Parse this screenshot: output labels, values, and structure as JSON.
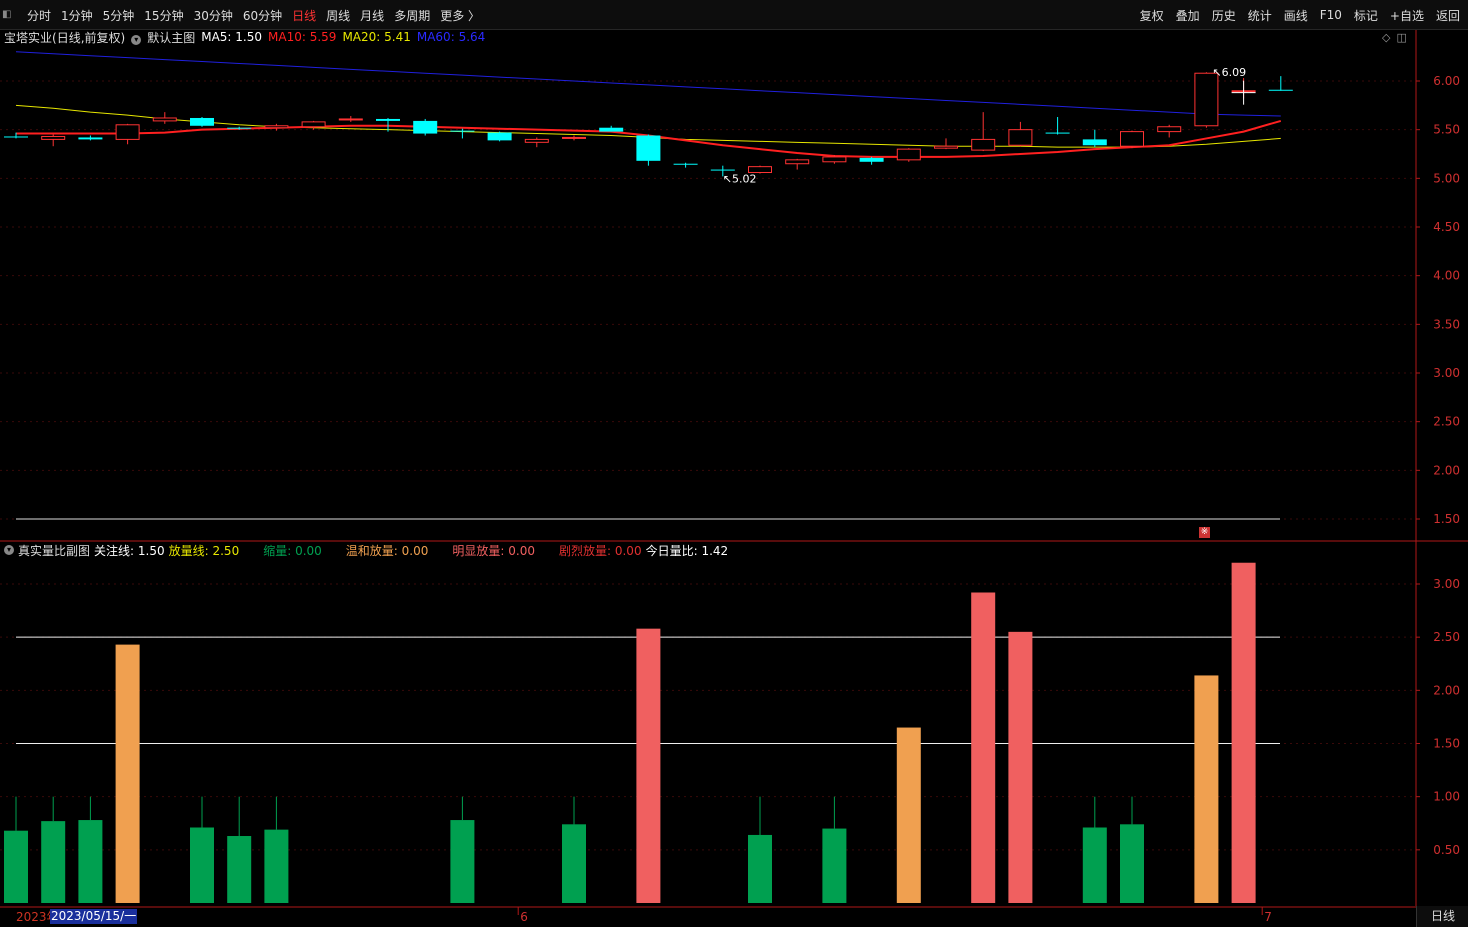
{
  "toolbar": {
    "periods": [
      "分时",
      "1分钟",
      "5分钟",
      "15分钟",
      "30分钟",
      "60分钟",
      "日线",
      "周线",
      "月线",
      "多周期",
      "更多 〉"
    ],
    "active_period": "日线",
    "tools": [
      "复权",
      "叠加",
      "历史",
      "统计",
      "画线",
      "F10",
      "标记",
      "+自选",
      "返回"
    ]
  },
  "main_info": {
    "stock_name": "宝塔实业",
    "mode": "(日线,前复权)",
    "template": "默认主图",
    "ma5_label": "MA5:",
    "ma5_value": "1.50",
    "ma10_label": "MA10:",
    "ma10_value": "5.59",
    "ma20_label": "MA20:",
    "ma20_value": "5.41",
    "ma60_label": "MA60:",
    "ma60_value": "5.64"
  },
  "sub_info": {
    "title": "真实量比副图",
    "focus_label": "关注线:",
    "focus_value": "1.50",
    "expand_label": "放量线:",
    "expand_value": "2.50",
    "shrink_label": "缩量:",
    "shrink_value": "0.00",
    "mild_label": "温和放量:",
    "mild_value": "0.00",
    "obvious_label": "明显放量:",
    "obvious_value": "0.00",
    "fierce_label": "剧烈放量:",
    "fierce_value": "0.00",
    "today_label": "今日量比:",
    "today_value": "1.42"
  },
  "colors": {
    "up": "#ff3333",
    "down": "#00ffff",
    "ma5": "#ffffff",
    "ma10": "#ff2020",
    "ma20": "#e6e600",
    "ma60": "#2020dd",
    "shrink": "#00a050",
    "mild": "#f0a050",
    "obvious": "#f06060",
    "axis": "#b01818"
  },
  "bottom": {
    "date_left": "2023年",
    "date_selected": "2023/05/15/一",
    "month_6": "6",
    "month_7": "7",
    "period": "日线"
  },
  "chart_data": [
    {
      "type": "candlestick",
      "yticks": [
        "6.00",
        "5.50",
        "5.00",
        "4.50",
        "4.00",
        "3.50",
        "3.00",
        "2.50",
        "2.00",
        "1.50"
      ],
      "ylim": [
        1.5,
        6.0
      ],
      "annotations": [
        {
          "text": "6.09",
          "label": "high"
        },
        {
          "text": "5.02",
          "label": "low"
        }
      ],
      "candles": [
        {
          "o": 5.43,
          "h": 5.47,
          "l": 5.41,
          "c": 5.42
        },
        {
          "o": 5.4,
          "h": 5.45,
          "l": 5.33,
          "c": 5.43
        },
        {
          "o": 5.42,
          "h": 5.44,
          "l": 5.39,
          "c": 5.4
        },
        {
          "o": 5.4,
          "h": 5.56,
          "l": 5.35,
          "c": 5.55
        },
        {
          "o": 5.59,
          "h": 5.68,
          "l": 5.56,
          "c": 5.62
        },
        {
          "o": 5.62,
          "h": 5.63,
          "l": 5.53,
          "c": 5.54
        },
        {
          "o": 5.52,
          "h": 5.53,
          "l": 5.5,
          "c": 5.51
        },
        {
          "o": 5.52,
          "h": 5.56,
          "l": 5.49,
          "c": 5.54
        },
        {
          "o": 5.53,
          "h": 5.59,
          "l": 5.5,
          "c": 5.58
        },
        {
          "o": 5.61,
          "h": 5.64,
          "l": 5.58,
          "c": 5.61
        },
        {
          "o": 5.61,
          "h": 5.62,
          "l": 5.48,
          "c": 5.59
        },
        {
          "o": 5.59,
          "h": 5.61,
          "l": 5.44,
          "c": 5.46
        },
        {
          "o": 5.49,
          "h": 5.51,
          "l": 5.41,
          "c": 5.48
        },
        {
          "o": 5.47,
          "h": 5.48,
          "l": 5.38,
          "c": 5.39
        },
        {
          "o": 5.37,
          "h": 5.42,
          "l": 5.32,
          "c": 5.4
        },
        {
          "o": 5.41,
          "h": 5.44,
          "l": 5.39,
          "c": 5.42
        },
        {
          "o": 5.52,
          "h": 5.54,
          "l": 5.48,
          "c": 5.48
        },
        {
          "o": 5.44,
          "h": 5.45,
          "l": 5.13,
          "c": 5.18
        },
        {
          "o": 5.15,
          "h": 5.16,
          "l": 5.11,
          "c": 5.14
        },
        {
          "o": 5.09,
          "h": 5.13,
          "l": 5.02,
          "c": 5.08
        },
        {
          "o": 5.06,
          "h": 5.13,
          "l": 5.05,
          "c": 5.12
        },
        {
          "o": 5.15,
          "h": 5.2,
          "l": 5.09,
          "c": 5.19
        },
        {
          "o": 5.17,
          "h": 5.24,
          "l": 5.15,
          "c": 5.22
        },
        {
          "o": 5.21,
          "h": 5.22,
          "l": 5.14,
          "c": 5.17
        },
        {
          "o": 5.19,
          "h": 5.31,
          "l": 5.17,
          "c": 5.3
        },
        {
          "o": 5.31,
          "h": 5.41,
          "l": 5.3,
          "c": 5.33
        },
        {
          "o": 5.29,
          "h": 5.68,
          "l": 5.28,
          "c": 5.4
        },
        {
          "o": 5.34,
          "h": 5.58,
          "l": 5.33,
          "c": 5.5
        },
        {
          "o": 5.47,
          "h": 5.63,
          "l": 5.45,
          "c": 5.46
        },
        {
          "o": 5.4,
          "h": 5.5,
          "l": 5.32,
          "c": 5.34
        },
        {
          "o": 5.33,
          "h": 5.49,
          "l": 5.31,
          "c": 5.48
        },
        {
          "o": 5.48,
          "h": 5.55,
          "l": 5.42,
          "c": 5.53
        },
        {
          "o": 5.54,
          "h": 6.09,
          "l": 5.52,
          "c": 6.08
        },
        {
          "o": 5.9,
          "h": 6.03,
          "l": 5.82,
          "c": 5.9
        },
        {
          "o": 5.91,
          "h": 6.05,
          "l": 5.9,
          "c": 5.9
        }
      ],
      "ma10": [
        5.46,
        5.46,
        5.46,
        5.46,
        5.47,
        5.5,
        5.51,
        5.52,
        5.53,
        5.54,
        5.54,
        5.53,
        5.52,
        5.51,
        5.5,
        5.49,
        5.48,
        5.44,
        5.39,
        5.34,
        5.3,
        5.26,
        5.23,
        5.22,
        5.22,
        5.22,
        5.23,
        5.25,
        5.27,
        5.3,
        5.32,
        5.34,
        5.41,
        5.48,
        5.59
      ],
      "ma20": [
        5.75,
        5.72,
        5.68,
        5.65,
        5.61,
        5.58,
        5.55,
        5.53,
        5.52,
        5.51,
        5.5,
        5.49,
        5.48,
        5.47,
        5.46,
        5.45,
        5.44,
        5.42,
        5.4,
        5.39,
        5.38,
        5.37,
        5.36,
        5.35,
        5.34,
        5.33,
        5.33,
        5.33,
        5.32,
        5.32,
        5.32,
        5.33,
        5.35,
        5.38,
        5.41
      ],
      "ma60": [
        6.3,
        6.28,
        6.26,
        6.24,
        6.22,
        6.2,
        6.18,
        6.16,
        6.14,
        6.12,
        6.1,
        6.08,
        6.06,
        6.04,
        6.02,
        6.0,
        5.98,
        5.96,
        5.94,
        5.92,
        5.9,
        5.88,
        5.86,
        5.84,
        5.82,
        5.8,
        5.78,
        5.76,
        5.74,
        5.72,
        5.7,
        5.68,
        5.66,
        5.65,
        5.64
      ]
    },
    {
      "type": "bar",
      "yticks": [
        "3.00",
        "2.50",
        "2.00",
        "1.50",
        "1.00",
        "0.50"
      ],
      "ylim": [
        0,
        3.3
      ],
      "reference_lines": [
        2.5,
        1.5
      ],
      "bars": [
        {
          "value": 0.68,
          "cls": "shrink"
        },
        {
          "value": 0.77,
          "cls": "shrink"
        },
        {
          "value": 0.78,
          "cls": "shrink"
        },
        {
          "value": 2.43,
          "cls": "mild"
        },
        null,
        {
          "value": 0.71,
          "cls": "shrink"
        },
        {
          "value": 0.63,
          "cls": "shrink"
        },
        {
          "value": 0.69,
          "cls": "shrink"
        },
        null,
        null,
        null,
        null,
        {
          "value": 0.78,
          "cls": "shrink"
        },
        null,
        null,
        {
          "value": 0.74,
          "cls": "shrink"
        },
        null,
        {
          "value": 2.58,
          "cls": "obvious"
        },
        null,
        null,
        {
          "value": 0.64,
          "cls": "shrink"
        },
        null,
        {
          "value": 0.7,
          "cls": "shrink"
        },
        null,
        {
          "value": 1.65,
          "cls": "mild"
        },
        null,
        {
          "value": 2.92,
          "cls": "obvious"
        },
        {
          "value": 2.55,
          "cls": "obvious"
        },
        null,
        {
          "value": 0.71,
          "cls": "shrink"
        },
        {
          "value": 0.74,
          "cls": "shrink"
        },
        null,
        {
          "value": 2.14,
          "cls": "mild"
        },
        {
          "value": 3.2,
          "cls": "obvious"
        },
        null
      ]
    }
  ]
}
